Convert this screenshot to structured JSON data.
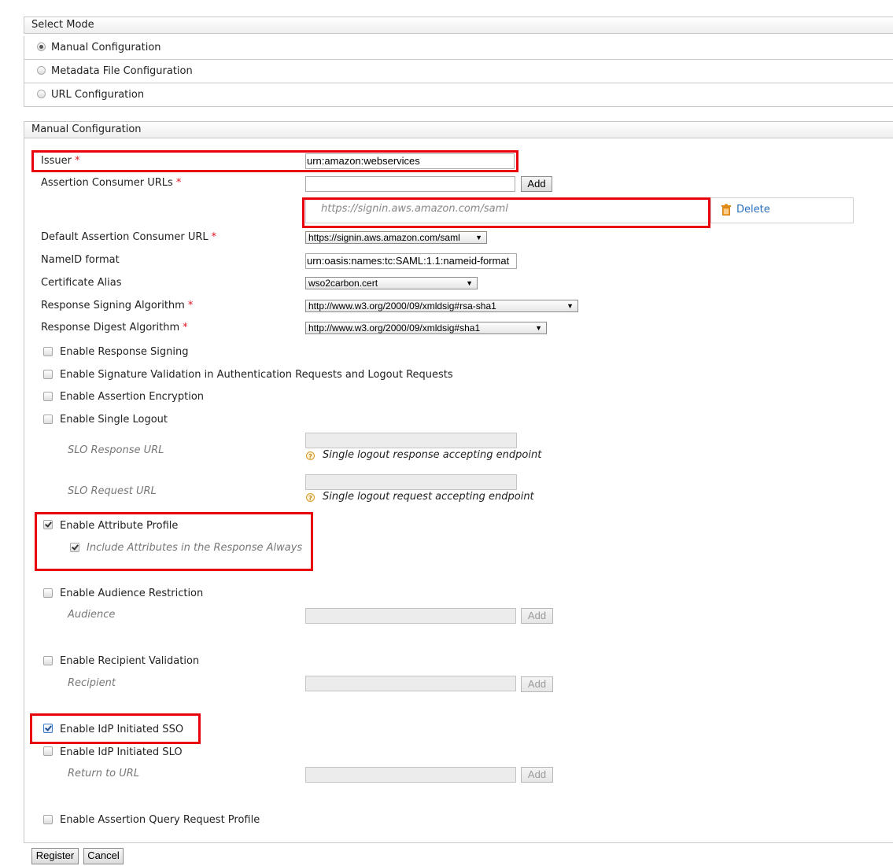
{
  "select_mode": {
    "title": "Select Mode",
    "options": [
      {
        "label": "Manual Configuration",
        "selected": true
      },
      {
        "label": "Metadata File Configuration",
        "selected": false
      },
      {
        "label": "URL Configuration",
        "selected": false
      }
    ]
  },
  "manual": {
    "title": "Manual Configuration",
    "required_mark": "*",
    "issuer": {
      "label": "Issuer",
      "value": "urn:amazon:webservices"
    },
    "acs": {
      "label": "Assertion Consumer URLs",
      "input_value": "",
      "add_label": "Add",
      "urls": [
        "https://signin.aws.amazon.com/saml"
      ],
      "delete_label": "Delete"
    },
    "default_acs": {
      "label": "Default Assertion Consumer URL",
      "value": "https://signin.aws.amazon.com/saml"
    },
    "nameid": {
      "label": "NameID format",
      "value": "urn:oasis:names:tc:SAML:1.1:nameid-format"
    },
    "cert_alias": {
      "label": "Certificate Alias",
      "value": "wso2carbon.cert"
    },
    "signing_alg": {
      "label": "Response Signing Algorithm",
      "value": "http://www.w3.org/2000/09/xmldsig#rsa-sha1"
    },
    "digest_alg": {
      "label": "Response Digest Algorithm",
      "value": "http://www.w3.org/2000/09/xmldsig#sha1"
    },
    "options": {
      "response_signing": {
        "label": "Enable Response Signing",
        "checked": false
      },
      "signature_validation": {
        "label": "Enable Signature Validation in Authentication Requests and Logout Requests",
        "checked": false
      },
      "assertion_encryption": {
        "label": "Enable Assertion Encryption",
        "checked": false
      },
      "single_logout": {
        "label": "Enable Single Logout",
        "checked": false
      },
      "attribute_profile": {
        "label": "Enable Attribute Profile",
        "checked": true
      },
      "include_attributes": {
        "label": "Include Attributes in the Response Always",
        "checked": true
      },
      "audience_restriction": {
        "label": "Enable Audience Restriction",
        "checked": false
      },
      "recipient_validation": {
        "label": "Enable Recipient Validation",
        "checked": false
      },
      "idp_sso": {
        "label": "Enable IdP Initiated SSO",
        "checked": true
      },
      "idp_slo": {
        "label": "Enable IdP Initiated SLO",
        "checked": false
      },
      "assertion_query": {
        "label": "Enable Assertion Query Request Profile",
        "checked": false
      }
    },
    "slo_response": {
      "label": "SLO Response URL",
      "help": "Single logout response accepting endpoint"
    },
    "slo_request": {
      "label": "SLO Request URL",
      "help": "Single logout request accepting endpoint"
    },
    "audience": {
      "label": "Audience",
      "add_label": "Add"
    },
    "recipient": {
      "label": "Recipient",
      "add_label": "Add"
    },
    "return_url": {
      "label": "Return to URL",
      "add_label": "Add"
    }
  },
  "footer": {
    "register_label": "Register",
    "cancel_label": "Cancel"
  }
}
